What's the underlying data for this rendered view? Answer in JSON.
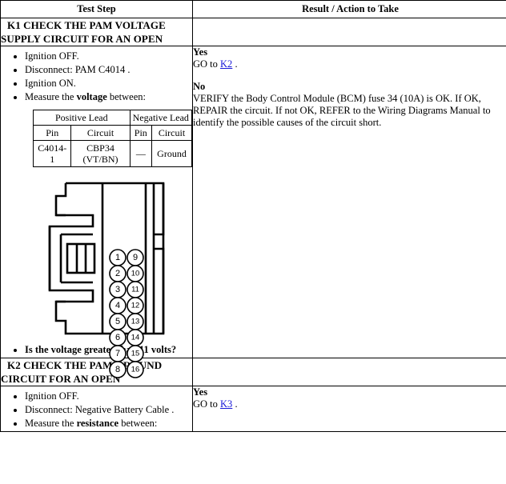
{
  "table": {
    "headers": {
      "step": "Test Step",
      "result": "Result / Action to Take"
    }
  },
  "steps": [
    {
      "id": "K1",
      "title_line1": "K1 CHECK THE PAM VOLTAGE",
      "title_line2": "SUPPLY CIRCUIT FOR AN OPEN",
      "bullets": [
        "Ignition OFF.",
        "Disconnect: PAM C4014 .",
        "Ignition ON.",
        "Measure the voltage between:"
      ],
      "bullet_bold_word": "voltage",
      "leads_table": {
        "group_positive": "Positive Lead",
        "group_negative": "Negative Lead",
        "col_pin": "Pin",
        "col_circuit": "Circuit",
        "row": {
          "pos_pin": "C4014-1",
          "pos_circuit_line1": "CBP34",
          "pos_circuit_line2": "(VT/BN)",
          "neg_pin": "—",
          "neg_circuit": "Ground"
        }
      },
      "connector": {
        "name": "PAM C4014 connector face view",
        "pins_left": [
          "1",
          "2",
          "3",
          "4",
          "5",
          "6",
          "7",
          "8"
        ],
        "pins_right": [
          "9",
          "10",
          "11",
          "12",
          "13",
          "14",
          "15",
          "16"
        ]
      },
      "question": "Is the voltage greater than 11 volts?",
      "result": {
        "yes_label": "Yes",
        "yes_text_pre": "GO to ",
        "yes_link": "K2",
        "yes_text_post": " .",
        "no_label": "No",
        "no_text": "VERIFY the Body Control Module (BCM) fuse 34 (10A) is OK. If OK, REPAIR the circuit. If not OK, REFER to the Wiring Diagrams Manual to identify the possible causes of the circuit short."
      }
    },
    {
      "id": "K2",
      "title_line1": "K2 CHECK THE PAM GROUND",
      "title_line2": "CIRCUIT FOR AN OPEN",
      "bullets": [
        "Ignition OFF.",
        "Disconnect: Negative Battery Cable .",
        "Measure the resistance between:"
      ],
      "bullet_bold_word": "resistance",
      "result": {
        "yes_label": "Yes",
        "yes_text_pre": "GO to ",
        "yes_link": "K3",
        "yes_text_post": " ."
      }
    }
  ],
  "colors": {
    "link": "#1818d8",
    "border": "#000000",
    "text": "#000000",
    "background": "#ffffff"
  }
}
